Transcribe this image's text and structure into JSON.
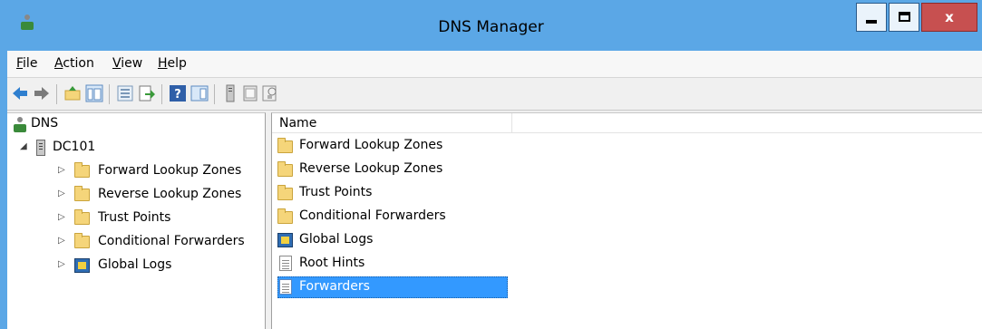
{
  "window": {
    "title": "DNS Manager",
    "close_glyph": "x"
  },
  "menu": {
    "file": {
      "accel": "F",
      "rest": "ile"
    },
    "action": {
      "accel": "A",
      "rest": "ction"
    },
    "view": {
      "accel": "V",
      "rest": "iew"
    },
    "help": {
      "accel": "H",
      "rest": "elp"
    }
  },
  "toolbar_icons": [
    "back-arrow-icon",
    "forward-arrow-icon",
    "up-folder-icon",
    "show-console-tree-icon",
    "properties-icon",
    "export-list-icon",
    "help-icon",
    "show-action-pane-icon",
    "server-icon",
    "record-icon",
    "filter-icon"
  ],
  "tree": {
    "root": "DNS",
    "server": "DC101",
    "children": [
      {
        "label": "Forward Lookup Zones",
        "icon": "folder-icon"
      },
      {
        "label": "Reverse Lookup Zones",
        "icon": "folder-icon"
      },
      {
        "label": "Trust Points",
        "icon": "folder-icon"
      },
      {
        "label": "Conditional Forwarders",
        "icon": "folder-icon"
      },
      {
        "label": "Global Logs",
        "icon": "logs-icon"
      }
    ]
  },
  "list": {
    "column_name": "Name",
    "items": [
      {
        "label": "Forward Lookup Zones",
        "icon": "folder-icon"
      },
      {
        "label": "Reverse Lookup Zones",
        "icon": "folder-icon"
      },
      {
        "label": "Trust Points",
        "icon": "folder-icon"
      },
      {
        "label": "Conditional Forwarders",
        "icon": "folder-icon"
      },
      {
        "label": "Global Logs",
        "icon": "logs-icon"
      },
      {
        "label": "Root Hints",
        "icon": "document-icon"
      },
      {
        "label": "Forwarders",
        "icon": "document-icon",
        "selected": true
      }
    ]
  },
  "colors": {
    "title_bar": "#5ba7e6",
    "selection": "#3399ff",
    "close_button": "#c75050"
  }
}
